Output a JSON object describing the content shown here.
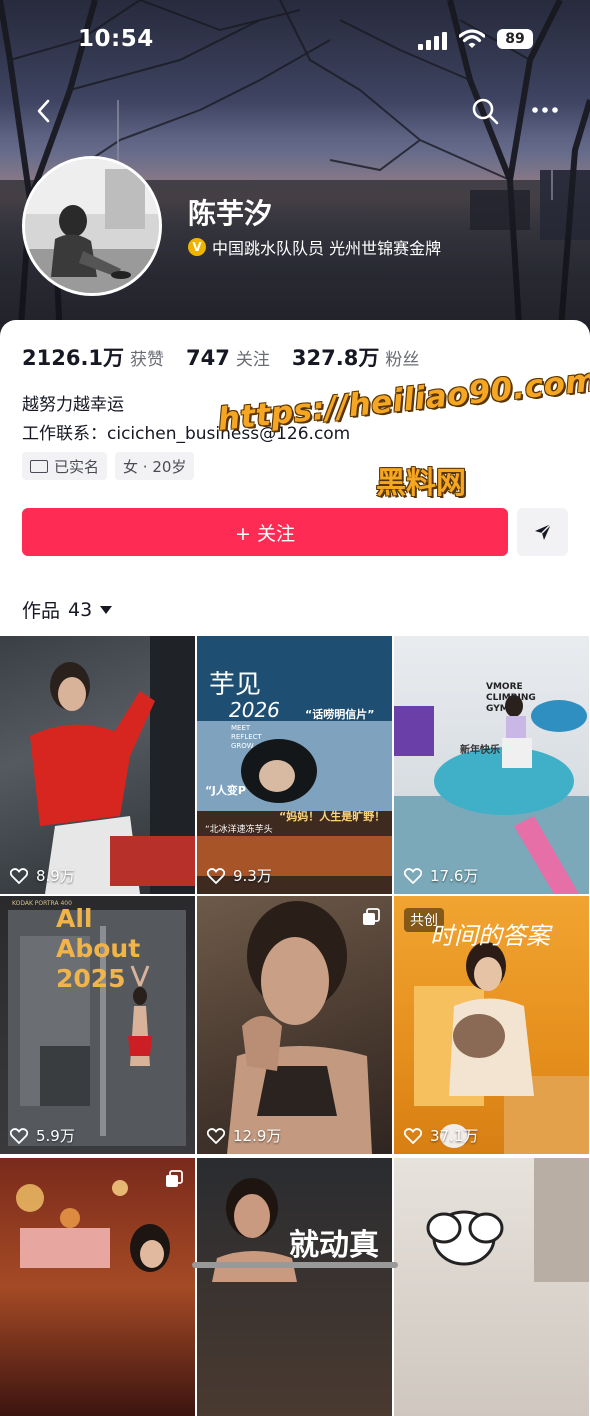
{
  "status_bar": {
    "time": "10:54",
    "battery": "89"
  },
  "profile": {
    "name": "陈芋汐",
    "verification": "中国跳水队队员 光州世锦赛金牌",
    "verify_badge": "V"
  },
  "stats": [
    {
      "value": "2126.1万",
      "label": "获赞"
    },
    {
      "value": "747",
      "label": "关注"
    },
    {
      "value": "327.8万",
      "label": "粉丝"
    }
  ],
  "bio": {
    "line1": "越努力越幸运",
    "line2": "工作联系：cicichen_business@126.com"
  },
  "tags": {
    "verified": "已实名",
    "info": "女 · 20岁"
  },
  "watermark": {
    "url": "https://heiliao90.com",
    "name": "黑料网"
  },
  "actions": {
    "follow": "+ 关注"
  },
  "works": {
    "label": "作品",
    "count": "43"
  },
  "grid": [
    {
      "likes": "8.9万"
    },
    {
      "likes": "9.3万",
      "texts": [
        "芋见",
        "2026",
        "“话唠明信片”",
        "MEET REFLECT GROW",
        "“J人变P",
        "“妈妈！人生是旷野！",
        "“北冰洋速冻芋头"
      ]
    },
    {
      "likes": "17.6万",
      "texts": [
        "VMORE CLIMBING GYM",
        "新年快乐"
      ]
    },
    {
      "likes": "5.9万",
      "texts": [
        "KODAK PORTRA 400",
        "All About 2025"
      ]
    },
    {
      "likes": "12.9万"
    },
    {
      "likes": "37.1万",
      "badge": "共创",
      "texts": [
        "时间的答案"
      ]
    },
    {
      "texts": []
    },
    {
      "texts": [
        "就动真"
      ]
    },
    {
      "texts": []
    }
  ],
  "colors": {
    "accent": "#fe2c55",
    "verify": "#f0b400",
    "watermark": "#f5a623"
  }
}
